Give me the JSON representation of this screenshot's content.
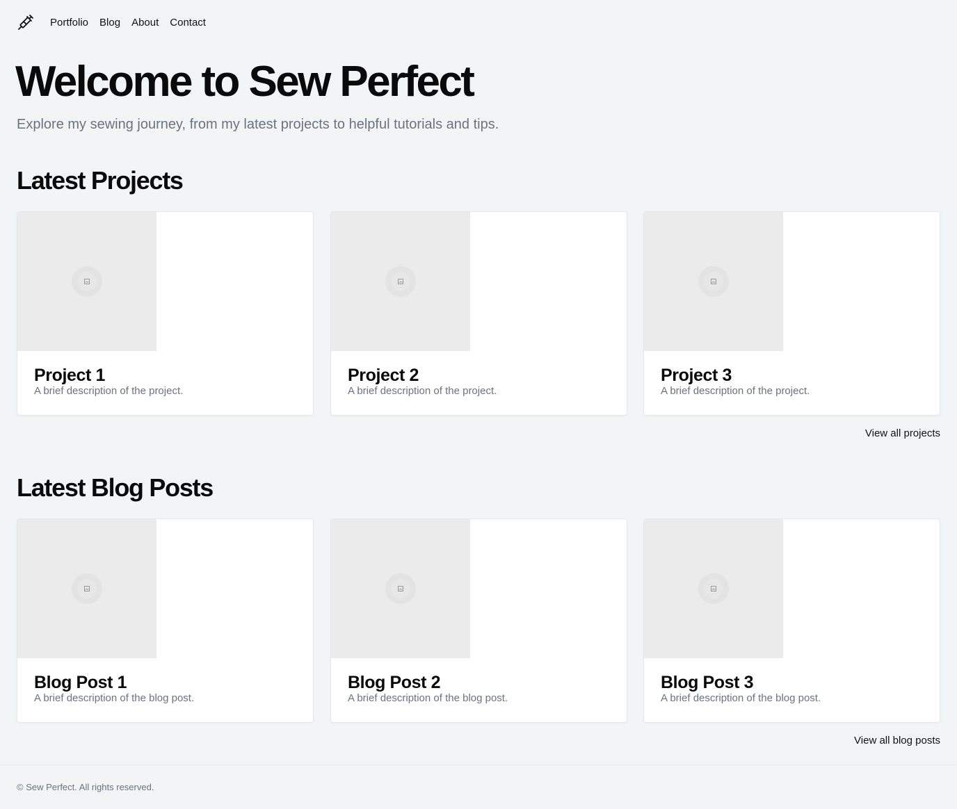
{
  "header": {
    "logo_icon": "needle-pen-icon",
    "nav": [
      {
        "label": "Portfolio"
      },
      {
        "label": "Blog"
      },
      {
        "label": "About"
      },
      {
        "label": "Contact"
      }
    ]
  },
  "hero": {
    "title": "Welcome to Sew Perfect",
    "subtitle": "Explore my sewing journey, from my latest projects to helpful tutorials and tips."
  },
  "projects": {
    "heading": "Latest Projects",
    "items": [
      {
        "title": "Project 1",
        "description": "A brief description of the project."
      },
      {
        "title": "Project 2",
        "description": "A brief description of the project."
      },
      {
        "title": "Project 3",
        "description": "A brief description of the project."
      }
    ],
    "view_all": "View all projects"
  },
  "blog": {
    "heading": "Latest Blog Posts",
    "items": [
      {
        "title": "Blog Post 1",
        "description": "A brief description of the blog post."
      },
      {
        "title": "Blog Post 2",
        "description": "A brief description of the blog post."
      },
      {
        "title": "Blog Post 3",
        "description": "A brief description of the blog post."
      }
    ],
    "view_all": "View all blog posts"
  },
  "footer": {
    "text": "© Sew Perfect. All rights reserved."
  },
  "colors": {
    "background": "#f3f4f6",
    "card": "#ffffff",
    "image_placeholder": "#ebebeb",
    "muted_text": "#6b7280",
    "text": "#0a0a0a"
  }
}
